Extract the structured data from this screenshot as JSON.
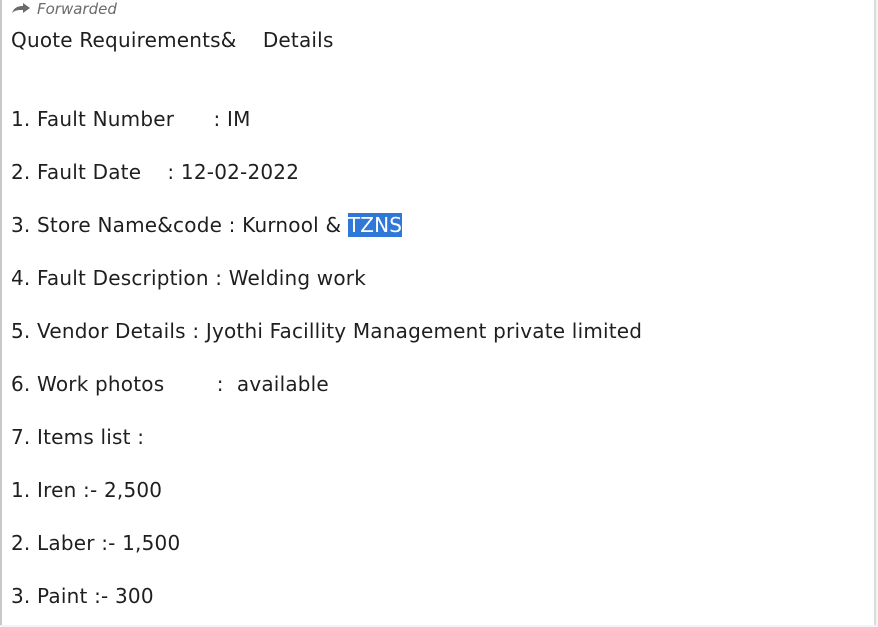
{
  "forwarded_label": "Forwarded",
  "title": "Quote Requirements&    Details",
  "lines": [
    "1. Fault Number      : IM",
    "2. Fault Date    : 12-02-2022",
    "3. Store Name&code : Kurnool & ",
    "4. Fault Description : Welding work",
    "5. Vendor Details : Jyothi Facillity Management private limited",
    "6. Work photos        :  available",
    "7. Items list :",
    "1. Iren :- 2,500",
    "2. Laber :- 1,500",
    "3. Paint :- 300"
  ],
  "store_code_selected": "TZNS"
}
